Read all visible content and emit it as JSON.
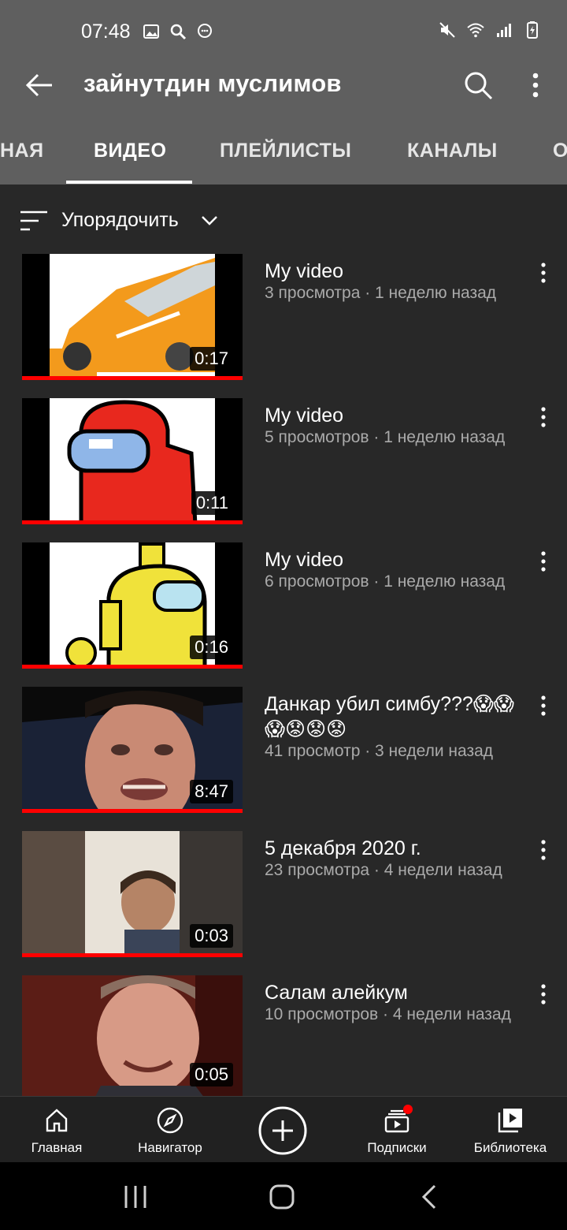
{
  "status_bar": {
    "time": "07:48",
    "left_icons": [
      "gallery-icon",
      "search-icon",
      "chat-icon"
    ],
    "right_icons": [
      "mute-icon",
      "wifi-icon",
      "signal-icon",
      "battery-icon"
    ]
  },
  "app_bar": {
    "title": "зайнутдин муслимов",
    "back_icon": "arrow-left-icon",
    "search_icon": "search-icon",
    "more_icon": "more-vert-icon"
  },
  "tabs": [
    {
      "label": "НАЯ"
    },
    {
      "label": "ВИДЕО",
      "active": true
    },
    {
      "label": "ПЛЕЙЛИСТЫ"
    },
    {
      "label": "КАНАЛЫ"
    },
    {
      "label": "О"
    }
  ],
  "sort": {
    "label": "Упорядочить"
  },
  "videos": [
    {
      "title": "My video",
      "meta": "3 просмотра · 1 неделю назад",
      "duration": "0:17"
    },
    {
      "title": "My video",
      "meta": "5 просмотров · 1 неделю назад",
      "duration": "0:11"
    },
    {
      "title": "My video",
      "meta": "6 просмотров · 1 неделю назад",
      "duration": "0:16"
    },
    {
      "title": "Данкар убил симбу???😱😱😱😟😟😟",
      "meta": "41 просмотр · 3 недели назад",
      "duration": "8:47"
    },
    {
      "title": "5 декабря 2020 г.",
      "meta": "23 просмотра · 4 недели назад",
      "duration": "0:03"
    },
    {
      "title": "Салам алейкум",
      "meta": "10 просмотров · 4 недели назад",
      "duration": "0:05"
    }
  ],
  "bottom_nav": [
    {
      "label": "Главная",
      "icon": "home-icon"
    },
    {
      "label": "Навигатор",
      "icon": "compass-icon"
    },
    {
      "label": "",
      "icon": "plus-circle-icon"
    },
    {
      "label": "Подписки",
      "icon": "subscriptions-icon"
    },
    {
      "label": "Библиотека",
      "icon": "library-icon"
    }
  ],
  "colors": {
    "background": "#282828",
    "header": "#5f5f5f",
    "accent": "#ff0000",
    "meta_text": "#aaaaaa"
  }
}
